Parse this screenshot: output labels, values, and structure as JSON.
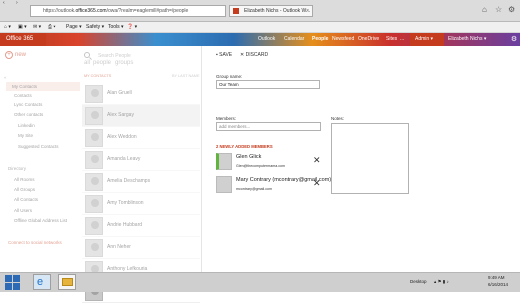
{
  "browser": {
    "url_prefix": "https://outlook.",
    "url_domain": "office365.com",
    "url_path": "/owa/?realm=eaglemill#path=/people",
    "tab_title": "Elizabeth Nichs - Outlook W...",
    "tab_close": "×"
  },
  "commandbar": {
    "page": "Page ▾",
    "safety": "Safety ▾",
    "tools": "Tools ▾",
    "help": "❓ ▾"
  },
  "suite": {
    "logo": "Office 365",
    "links": [
      "Outlook",
      "Calendar",
      "People",
      "Newsfeed",
      "OneDrive",
      "Sites"
    ],
    "more": "...",
    "admin": "Admin ▾",
    "user": "Elizabeth Nichs ▾",
    "gear": "⚙"
  },
  "left_nav": {
    "new_label": "new",
    "items": [
      {
        "label": "My Contacts",
        "indent": 1,
        "selected": true
      },
      {
        "label": "Contacts",
        "indent": 2
      },
      {
        "label": "Lync Contacts",
        "indent": 2
      },
      {
        "label": "Other contacts",
        "indent": 2
      },
      {
        "label": "Linkedin",
        "indent": 3
      },
      {
        "label": "My Site",
        "indent": 3
      },
      {
        "label": "Suggested Contacts",
        "indent": 3
      },
      {
        "label": "Directory",
        "indent": 1
      },
      {
        "label": "All Rooms",
        "indent": 2
      },
      {
        "label": "All Groups",
        "indent": 2
      },
      {
        "label": "All Contacts",
        "indent": 2
      },
      {
        "label": "All Users",
        "indent": 2
      },
      {
        "label": "Offline Global Address List",
        "indent": 2
      }
    ],
    "connect_social": "Connect to social networks"
  },
  "people_list": {
    "search_placeholder": "Search People",
    "filters": [
      "all",
      "people",
      "groups"
    ],
    "header_left": "MY CONTACTS",
    "header_right": "BY LAST NAME",
    "contacts": [
      {
        "name": "Alan Gruell",
        "selected": false
      },
      {
        "name": "Alex Sargay",
        "selected": true
      },
      {
        "name": "Alex Weddon",
        "selected": false
      },
      {
        "name": "Amanda Leavy",
        "selected": false
      },
      {
        "name": "Amelia Deschamps",
        "selected": false
      },
      {
        "name": "Amy Tomblinson",
        "selected": false
      },
      {
        "name": "Andrie Hubbard",
        "selected": false
      },
      {
        "name": "Ann Neher",
        "selected": false
      },
      {
        "name": "Anthony Lefkouria",
        "selected": false
      },
      {
        "name": "Ashish S. Prasad",
        "selected": false
      }
    ]
  },
  "form": {
    "save_label": "SAVE",
    "discard_label": "DISCARD",
    "group_name_label": "Group name:",
    "group_name_value": "Our Team",
    "members_label": "Members:",
    "members_placeholder": "add members...",
    "notes_label": "Notes:",
    "added_heading": "2 NEWLY ADDED MEMBERS",
    "members": [
      {
        "name": "Glen Glick",
        "email": "Glen@thecomputermama.com"
      },
      {
        "name": "Mary Contrary (mcontrary@gmail.com)",
        "email": "mcontrary@gmail.com"
      }
    ],
    "remove_glyph": "✕"
  },
  "taskbar": {
    "desktop": "Desktop",
    "time": "9:49 AM",
    "date": "6/16/2014"
  },
  "colors": {
    "accent": "#c43b1d",
    "selection": "#f5dcd4"
  }
}
